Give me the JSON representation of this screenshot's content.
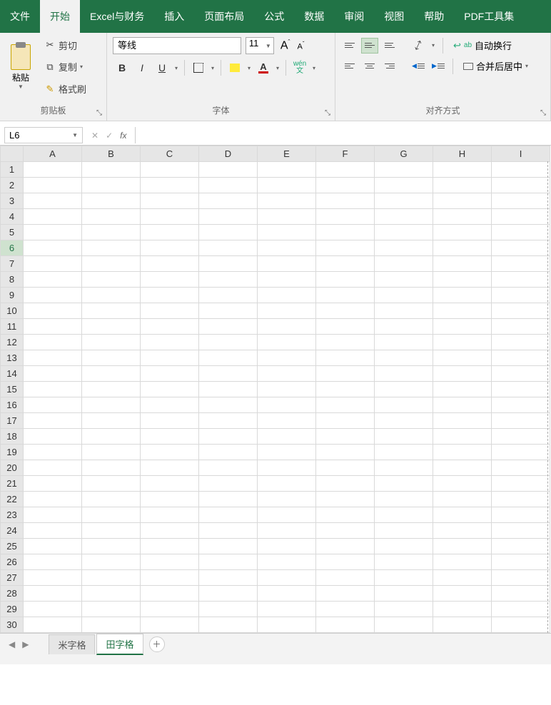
{
  "menu": {
    "tabs": [
      "文件",
      "开始",
      "Excel与财务",
      "插入",
      "页面布局",
      "公式",
      "数据",
      "审阅",
      "视图",
      "帮助",
      "PDF工具集"
    ],
    "active": "开始"
  },
  "ribbon": {
    "clipboard": {
      "paste": "粘贴",
      "cut": "剪切",
      "copy": "复制",
      "format_painter": "格式刷",
      "label": "剪贴板"
    },
    "font": {
      "font_name": "等线",
      "font_size": "11",
      "bold": "B",
      "italic": "I",
      "underline": "U",
      "wen": "wén",
      "wen_sub": "文",
      "label": "字体"
    },
    "alignment": {
      "wrap": "自动换行",
      "merge": "合并后居中",
      "label": "对齐方式"
    }
  },
  "namebox": "L6",
  "fx_label": "fx",
  "columns": [
    "A",
    "B",
    "C",
    "D",
    "E",
    "F",
    "G",
    "H",
    "I"
  ],
  "row_count": 30,
  "selected_row": 6,
  "sheets": {
    "inactive": "米字格",
    "active": "田字格"
  }
}
